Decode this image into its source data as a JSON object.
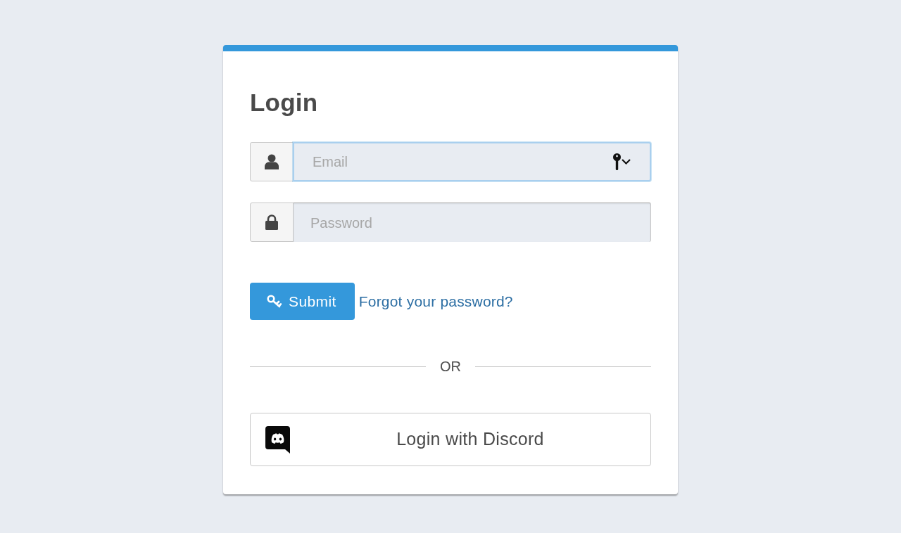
{
  "login": {
    "title": "Login",
    "fields": [
      {
        "kind": "email",
        "placeholder": "Email",
        "focused": true,
        "autofill": true
      },
      {
        "kind": "password",
        "placeholder": "Password",
        "focused": false,
        "autofill": false
      }
    ],
    "submit": {
      "label": "Submit"
    },
    "forgot_link": "Forgot your password?",
    "divider": "OR",
    "discord_button": {
      "label": "Login with Discord"
    }
  }
}
